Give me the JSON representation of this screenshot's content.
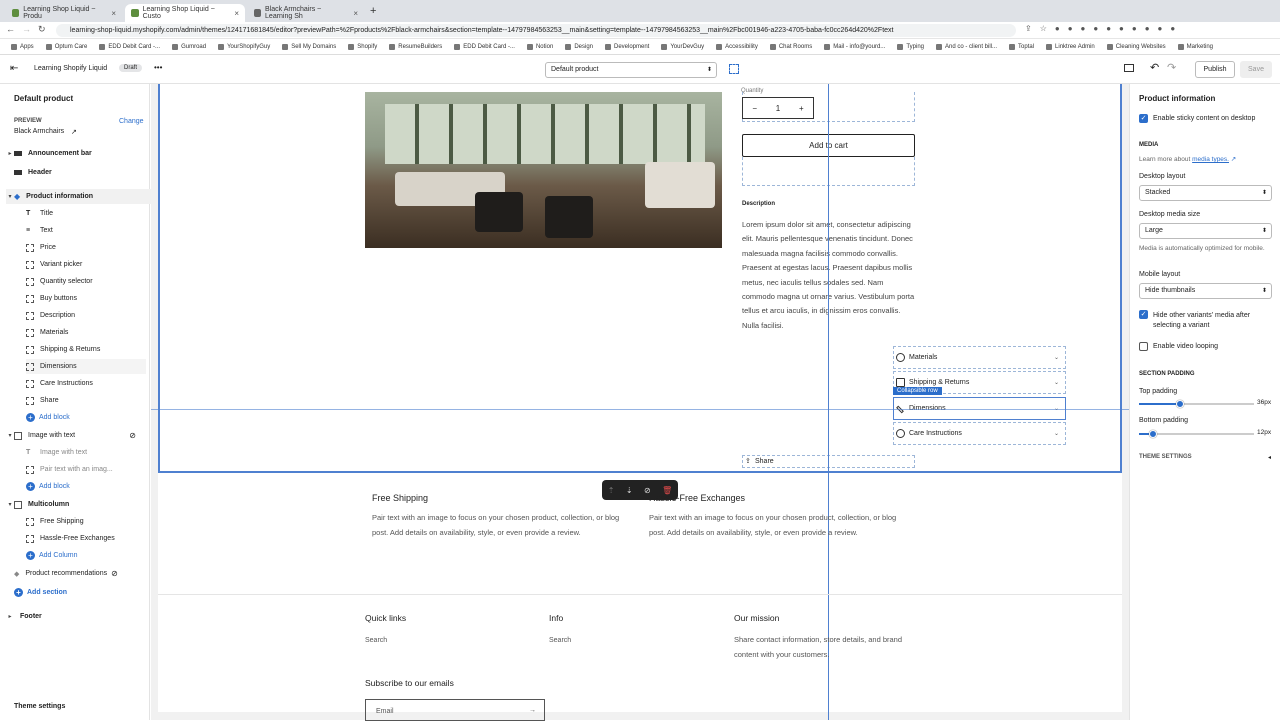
{
  "browser": {
    "tabs": [
      {
        "label": "Learning Shop Liquid ~ Produ"
      },
      {
        "label": "Learning Shop Liquid ~ Custo"
      },
      {
        "label": "Black Armchairs ~ Learning Sh"
      }
    ],
    "new_tab": "+",
    "url": "learning-shop-liquid.myshopify.com/admin/themes/124171681845/editor?previewPath=%2Fproducts%2Fblack-armchairs&section=template--14797984563253__main&setting=template--14797984563253__main%2Fbc001946-a223-4705-baba-fc0cc264d420%2Ftext",
    "bookmarks": [
      "Apps",
      "Optum Care",
      "EDD Debit Card -...",
      "Gumroad",
      "YourShopifyGuy",
      "Sell My Domains",
      "Shopify",
      "ResumeBuilders",
      "EDD Debit Card -...",
      "Notion",
      "Design",
      "Development",
      "YourDevGuy",
      "Accessibility",
      "Chat Rooms",
      "Mail - info@yourd...",
      "Typing",
      "And co - client bill...",
      "Toptal",
      "Linktree Admin",
      "Cleaning Websites",
      "Marketing"
    ]
  },
  "editor": {
    "store_name": "Learning Shopify Liquid",
    "status_badge": "Draft",
    "more": "•••",
    "template_select": "Default product",
    "publish": "Publish",
    "save": "Save"
  },
  "sidebar": {
    "title": "Default product",
    "preview_label": "PREVIEW",
    "preview_product": "Black Armchairs",
    "change": "Change",
    "sections": {
      "announcement": "Announcement bar",
      "header": "Header",
      "product_info": "Product information",
      "blocks": [
        "Title",
        "Text",
        "Price",
        "Variant picker",
        "Quantity selector",
        "Buy buttons",
        "Description",
        "Materials",
        "Shipping & Returns",
        "Dimensions",
        "Care Instructions",
        "Share"
      ],
      "add_block": "Add block",
      "image_with_text": "Image with text",
      "iwt_blocks": [
        "Image with text",
        "Pair text with an imag..."
      ],
      "add_block2": "Add block",
      "multicolumn": "Multicolumn",
      "mc_blocks": [
        "Free Shipping",
        "Hassle-Free Exchanges"
      ],
      "add_column": "Add Column",
      "product_recs": "Product recommendations",
      "add_section": "Add section",
      "footer": "Footer",
      "theme_settings": "Theme settings"
    }
  },
  "preview": {
    "qty_label": "Quantity",
    "qty_minus": "−",
    "qty_value": "1",
    "qty_plus": "+",
    "add_to_cart": "Add to cart",
    "description_heading": "Description",
    "description": "Lorem ipsum dolor sit amet, consectetur adipiscing elit. Mauris pellentesque venenatis tincidunt. Donec malesuada magna facilisis commodo convallis. Praesent at egestas lacus. Praesent dapibus mollis metus, nec iaculis tellus sodales sed. Nam commodo magna ut ornare varius. Vestibulum porta tellus et arcu iaculis, in dignissim eros convallis. Nulla facilisi.",
    "accordions": [
      "Materials",
      "Shipping & Returns",
      "Dimensions",
      "Care Instructions"
    ],
    "collapsible_tag": "Collapsible row",
    "share": "Share",
    "multicolumn": [
      {
        "title": "Free Shipping",
        "text": "Pair text with an image to focus on your chosen product, collection, or blog post. Add details on availability, style, or even provide a review."
      },
      {
        "title": "Hassle-Free Exchanges",
        "text": "Pair text with an image to focus on your chosen product, collection, or blog post. Add details on availability, style, or even provide a review."
      }
    ],
    "footer": {
      "quick_links": "Quick links",
      "quick_search": "Search",
      "info": "Info",
      "info_search": "Search",
      "mission": "Our mission",
      "mission_text": "Share contact information, store details, and brand content with your customers.",
      "subscribe": "Subscribe to our emails",
      "email_placeholder": "Email"
    }
  },
  "settings": {
    "title": "Product information",
    "sticky": "Enable sticky content on desktop",
    "media_heading": "MEDIA",
    "learn_more": "Learn more about",
    "media_types": "media types.",
    "desktop_layout_label": "Desktop layout",
    "desktop_layout": "Stacked",
    "desktop_media_size_label": "Desktop media size",
    "desktop_media_size": "Large",
    "media_note": "Media is automatically optimized for mobile.",
    "mobile_layout_label": "Mobile layout",
    "mobile_layout": "Hide thumbnails",
    "hide_variants": "Hide other variants' media after selecting a variant",
    "video_loop": "Enable video looping",
    "section_padding": "SECTION PADDING",
    "top_padding_label": "Top padding",
    "top_padding": "36px",
    "top_padding_fraction": 0.36,
    "bottom_padding_label": "Bottom padding",
    "bottom_padding": "12px",
    "bottom_padding_fraction": 0.12,
    "theme_settings": "THEME SETTINGS"
  }
}
